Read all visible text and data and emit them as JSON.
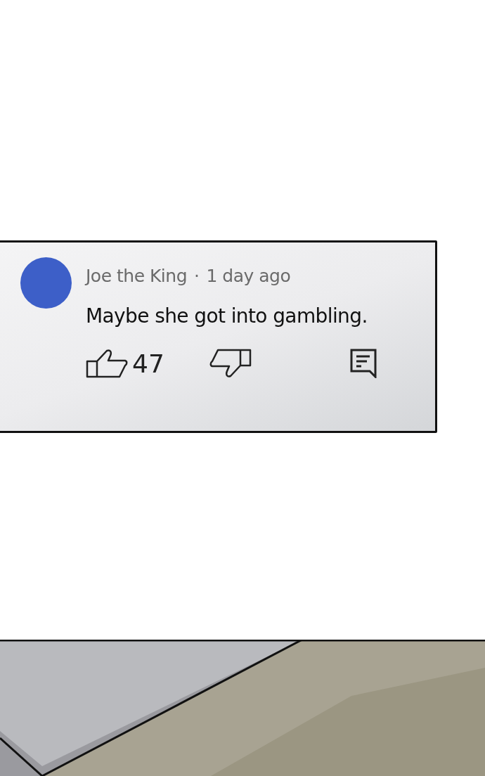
{
  "comment": {
    "author": "Joe the King",
    "separator": "·",
    "time": "1 day ago",
    "text": "Maybe she got into gambling.",
    "likes": "47"
  }
}
